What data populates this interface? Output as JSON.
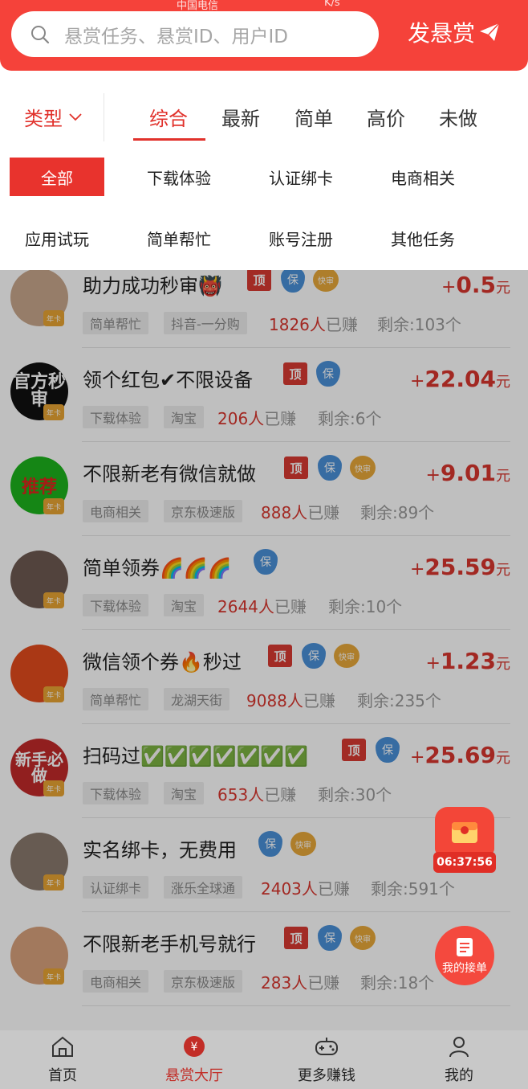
{
  "status": {
    "carrier": "中国电信",
    "net": "K/s"
  },
  "search": {
    "placeholder": "悬赏任务、悬赏ID、用户ID"
  },
  "header": {
    "post_label": "发悬赏"
  },
  "filter": {
    "type_label": "类型",
    "tabs": [
      "综合",
      "最新",
      "简单",
      "高价",
      "未做"
    ],
    "categories": [
      "全部",
      "下载体验",
      "认证绑卡",
      "电商相关",
      "应用试玩",
      "简单帮忙",
      "账号注册",
      "其他任务"
    ]
  },
  "tasks": [
    {
      "title": "助力成功秒审👹",
      "tags": [
        "简单帮忙",
        "抖音-一分购"
      ],
      "earned": "1826人",
      "earned_suffix": "已赚",
      "remain": "剩余:103个",
      "price": "0.5",
      "badges": [
        "顶",
        "保",
        "快审"
      ],
      "avatar_text": ""
    },
    {
      "title": "领个红包✔不限设备",
      "tags": [
        "下载体验",
        "淘宝"
      ],
      "earned": "206人",
      "earned_suffix": "已赚",
      "remain": "剩余:6个",
      "price": "22.04",
      "badges": [
        "顶",
        "保"
      ],
      "avatar_text": "官方秒审"
    },
    {
      "title": "不限新老有微信就做",
      "tags": [
        "电商相关",
        "京东极速版"
      ],
      "earned": "888人",
      "earned_suffix": "已赚",
      "remain": "剩余:89个",
      "price": "9.01",
      "badges": [
        "顶",
        "保",
        "快审"
      ],
      "avatar_text": "推荐"
    },
    {
      "title": "简单领券🌈🌈🌈",
      "tags": [
        "下载体验",
        "淘宝"
      ],
      "earned": "2644人",
      "earned_suffix": "已赚",
      "remain": "剩余:10个",
      "price": "25.59",
      "badges": [
        "保"
      ],
      "avatar_text": ""
    },
    {
      "title": "微信领个券🔥秒过",
      "tags": [
        "简单帮忙",
        "龙湖天街"
      ],
      "earned": "9088人",
      "earned_suffix": "已赚",
      "remain": "剩余:235个",
      "price": "1.23",
      "badges": [
        "顶",
        "保",
        "快审"
      ],
      "avatar_text": ""
    },
    {
      "title": "扫码过✅✅✅✅✅✅✅",
      "tags": [
        "下载体验",
        "淘宝"
      ],
      "earned": "653人",
      "earned_suffix": "已赚",
      "remain": "剩余:30个",
      "price": "25.69",
      "badges": [
        "顶",
        "保"
      ],
      "avatar_text": "新手必做"
    },
    {
      "title": "实名绑卡，无费用",
      "tags": [
        "认证绑卡",
        "涨乐全球通"
      ],
      "earned": "2403人",
      "earned_suffix": "已赚",
      "remain": "剩余:591个",
      "price": "",
      "badges": [
        "保",
        "快审"
      ],
      "avatar_text": ""
    },
    {
      "title": "不限新老手机号就行",
      "tags": [
        "电商相关",
        "京东极速版"
      ],
      "earned": "283人",
      "earned_suffix": "已赚",
      "remain": "剩余:18个",
      "price": "",
      "badges": [
        "顶",
        "保",
        "快审"
      ],
      "avatar_text": ""
    }
  ],
  "price_plus": "+",
  "price_unit": "元",
  "vip_label": "年卡",
  "floating": {
    "timer": "06:37:56",
    "my_orders": "我的接单"
  },
  "nav": [
    "首页",
    "悬赏大厅",
    "更多赚钱",
    "我的"
  ],
  "colors": {
    "brand": "#f5423a",
    "accent": "#e1322c",
    "price": "#d8362e"
  }
}
